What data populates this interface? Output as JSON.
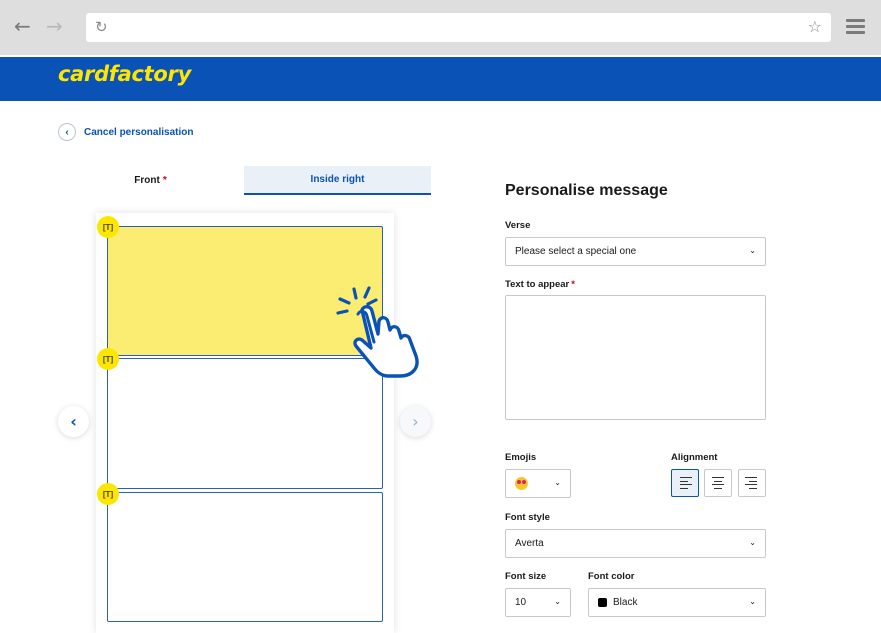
{
  "browser": {
    "back_icon": "←",
    "forward_icon": "→",
    "reload_icon": "↻",
    "star_icon": "☆"
  },
  "header": {
    "logo_text": "cardfactory",
    "brand_color": "#0a52b5",
    "logo_color": "#ffe600"
  },
  "cancel": {
    "icon": "‹",
    "label": "Cancel personalisation"
  },
  "tabs": [
    {
      "label": "Front",
      "required": "*",
      "active": false
    },
    {
      "label": "Inside right",
      "active": true
    }
  ],
  "card": {
    "field_badge": "[T]",
    "left_arrow": "‹",
    "right_arrow": "›"
  },
  "form": {
    "title": "Personalise message",
    "verse": {
      "label": "Verse",
      "value": "Please select a special one"
    },
    "text": {
      "label": "Text to appear",
      "required": "*",
      "value": ""
    },
    "emojis": {
      "label": "Emojis"
    },
    "alignment": {
      "label": "Alignment",
      "selected": "left"
    },
    "font_style": {
      "label": "Font style",
      "value": "Averta"
    },
    "font_size": {
      "label": "Font size",
      "value": "10"
    },
    "font_color": {
      "label": "Font color",
      "value": "Black",
      "swatch": "#000000"
    },
    "chevron": "⌄"
  }
}
